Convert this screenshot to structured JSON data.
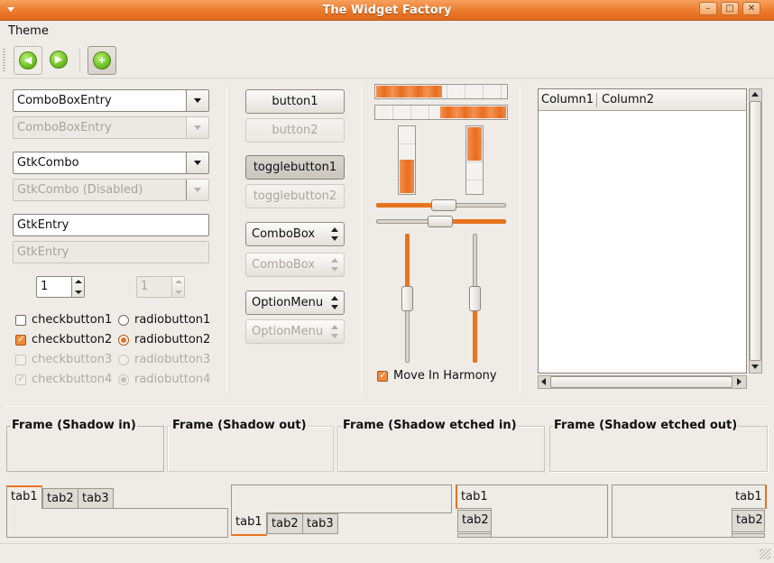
{
  "window": {
    "title": "The Widget Factory"
  },
  "menu": {
    "theme": "Theme"
  },
  "toolbar": {
    "icons": [
      "go-back-icon",
      "go-forward-icon",
      "add-icon"
    ]
  },
  "col1": {
    "combo_entry": "ComboBoxEntry",
    "combo_entry_disabled": "ComboBoxEntry",
    "gtk_combo": "GtkCombo",
    "gtk_combo_disabled": "GtkCombo (Disabled)",
    "entry": "GtkEntry",
    "entry_disabled": "GtkEntry",
    "spin_value": "1",
    "spin_disabled_value": "1",
    "checks": [
      "checkbutton1",
      "checkbutton2",
      "checkbutton3",
      "checkbutton4"
    ],
    "radios": [
      "radiobutton1",
      "radiobutton2",
      "radiobutton3",
      "radiobutton4"
    ]
  },
  "col2": {
    "button1": "button1",
    "button2": "button2",
    "toggle1": "togglebutton1",
    "toggle2": "togglebutton2",
    "combobox": "ComboBox",
    "combobox_disabled": "ComboBox",
    "optionmenu": "OptionMenu",
    "optionmenu_disabled": "OptionMenu"
  },
  "col3": {
    "progress_h1": 0.5,
    "progress_h2": 0.5,
    "progress_v1": 0.5,
    "progress_v2": 0.5,
    "harmony": "Move In Harmony"
  },
  "tree": {
    "columns": [
      "Column1",
      "Column2"
    ]
  },
  "frames": [
    "Frame (Shadow in)",
    "Frame (Shadow out)",
    "Frame (Shadow etched in)",
    "Frame (Shadow etched out)"
  ],
  "notebooks": {
    "tabs": [
      "tab1",
      "tab2",
      "tab3"
    ]
  },
  "colors": {
    "accent": "#e8741e",
    "background": "#efebe7"
  }
}
